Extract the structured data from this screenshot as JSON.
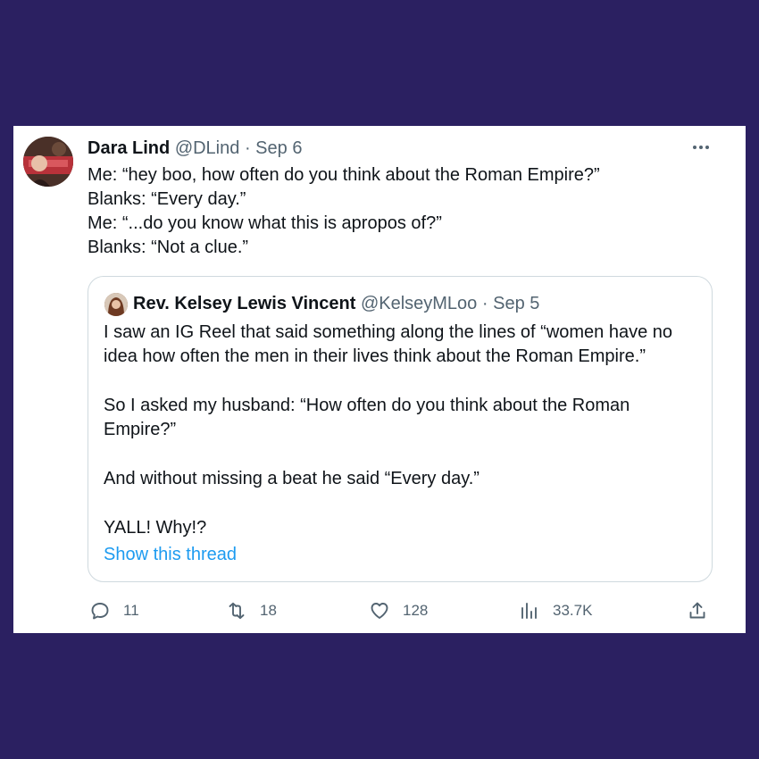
{
  "tweet": {
    "author_name": "Dara Lind",
    "handle": "@DLind",
    "separator": "·",
    "date": "Sep 6",
    "lines": [
      "Me: “hey boo, how often do you think about the Roman Empire?”",
      "Blanks: “Every day.”",
      "Me: “...do you know what this is apropos of?”",
      "Blanks: “Not a clue.”"
    ],
    "more_icon": "more-horizontal-icon"
  },
  "quote": {
    "author_name": "Rev. Kelsey Lewis Vincent",
    "handle": "@KelseyMLoo",
    "separator": "·",
    "date": "Sep 5",
    "paragraphs": [
      "I saw an IG Reel that said something along the lines of “women have no idea how often the men in their lives think about the Roman Empire.”",
      "So I asked my husband: “How often do you think about the Roman Empire?”",
      "And without missing a beat he said “Every day.”",
      "YALL! Why!?"
    ],
    "show_thread": "Show this thread"
  },
  "actions": {
    "replies": "11",
    "retweets": "18",
    "likes": "128",
    "views": "33.7K"
  },
  "colors": {
    "background": "#2b2061",
    "link": "#1d9bf0",
    "muted": "#536471"
  }
}
